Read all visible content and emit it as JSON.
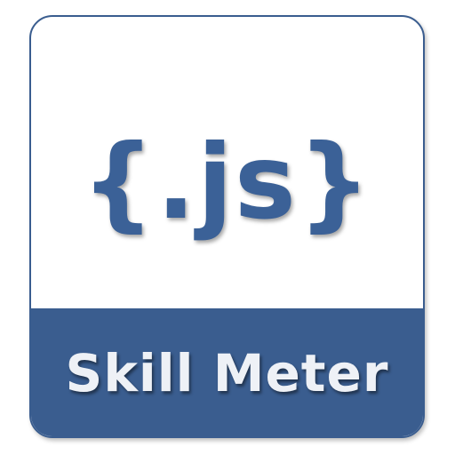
{
  "icon": {
    "logo_text": "{.js}",
    "title": "Skill Meter"
  },
  "colors": {
    "brand_blue": "#3a5d8f",
    "logo_blue": "#3b6197",
    "banner_text": "#eef1f6",
    "background": "#ffffff"
  }
}
